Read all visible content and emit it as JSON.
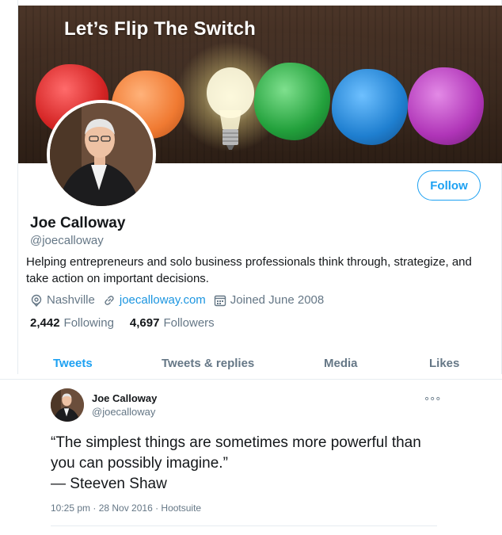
{
  "banner": {
    "title": "Let’s Flip The Switch"
  },
  "profile": {
    "name": "Joe Calloway",
    "handle": "@joecalloway",
    "bio": "Helping entrepreneurs and solo business professionals think through, strategize, and take action on important decisions.",
    "location": "Nashville",
    "website": "joecalloway.com",
    "joined": "Joined June 2008",
    "following_count": "2,442",
    "following_label": "Following",
    "followers_count": "4,697",
    "followers_label": "Followers",
    "follow_label": "Follow"
  },
  "tabs": [
    {
      "label": "Tweets"
    },
    {
      "label": "Tweets & replies"
    },
    {
      "label": "Media"
    },
    {
      "label": "Likes"
    }
  ],
  "tweet": {
    "name": "Joe Calloway",
    "handle": "@joecalloway",
    "text": "“The simplest things are sometimes more powerful than\nyou can possibly imagine.”\n— Steeven Shaw",
    "timestamp": "10:25 pm · 28 Nov 2016 · Hootsuite",
    "more_label": "∘∘∘"
  },
  "colors": {
    "accent": "#1da1f2",
    "link": "#1b95e0",
    "muted": "#657786",
    "text": "#14171a"
  },
  "icons": {
    "location": "location-pin-icon",
    "website": "link-icon",
    "joined": "calendar-icon",
    "more": "more-options-icon"
  }
}
